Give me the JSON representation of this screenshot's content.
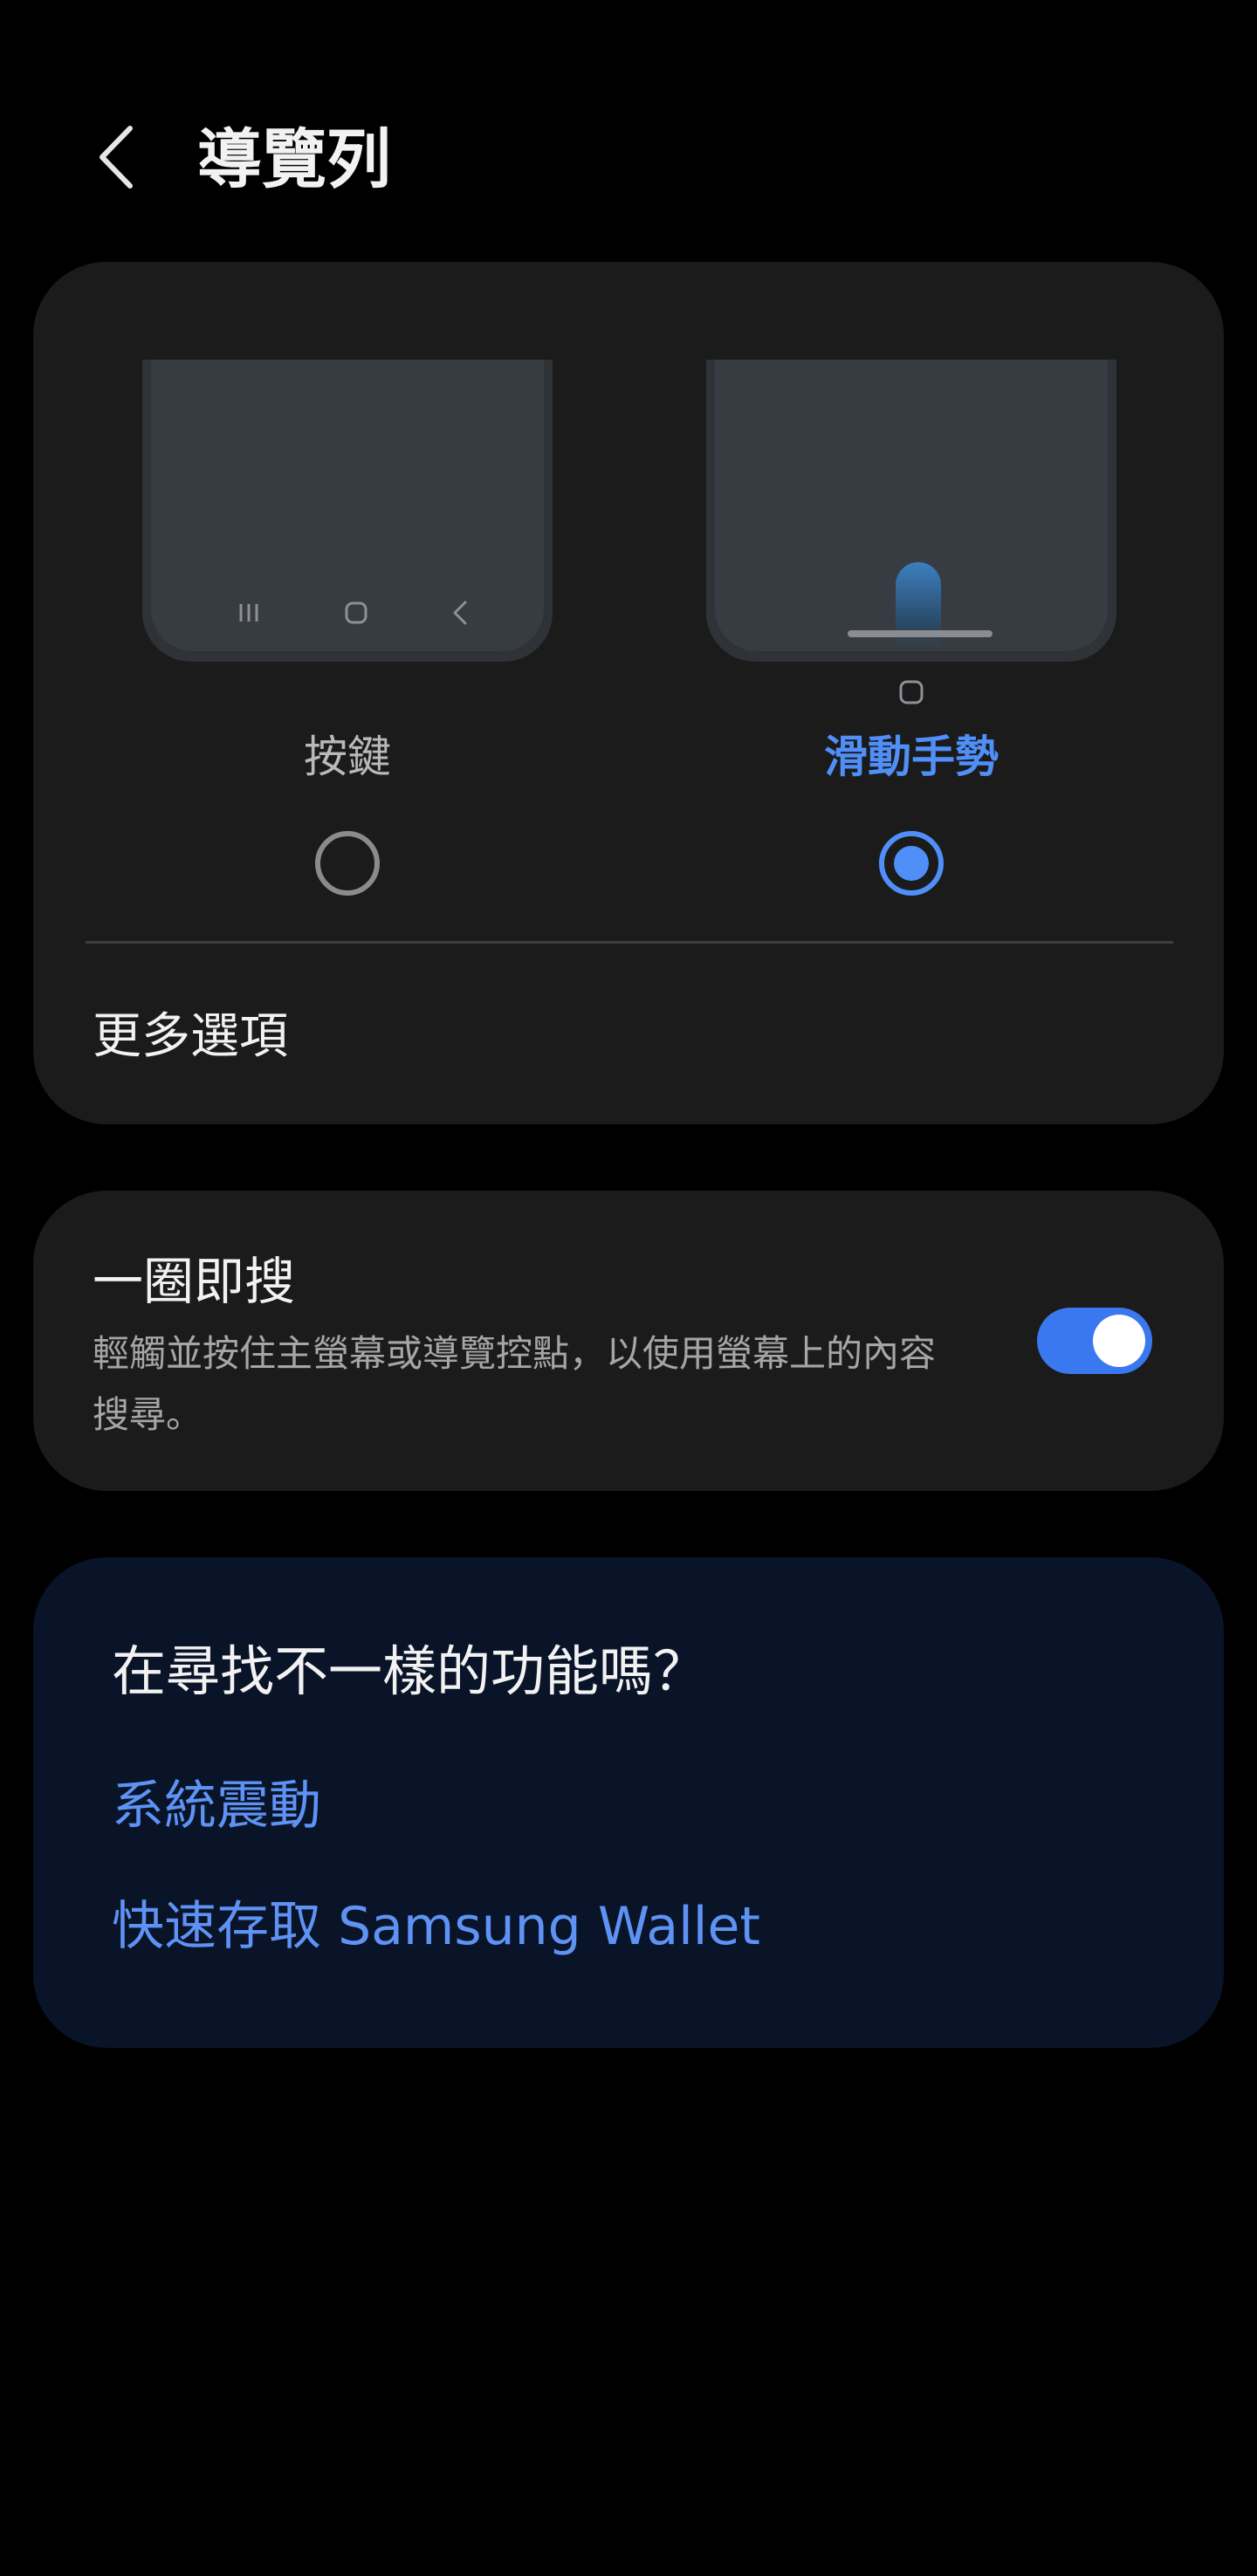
{
  "header": {
    "title": "導覽列",
    "back_icon": "chevron-left-icon"
  },
  "navigation_type": {
    "options": [
      {
        "label": "按鍵",
        "selected": false
      },
      {
        "label": "滑動手勢",
        "selected": true
      }
    ],
    "more_options_label": "更多選項"
  },
  "circle_to_search": {
    "title": "一圈即搜",
    "description": "輕觸並按住主螢幕或導覽控點，以使用螢幕上的內容搜尋。",
    "enabled": true
  },
  "suggestions": {
    "title": "在尋找不一樣的功能嗎？",
    "links": [
      "系統震動",
      "快速存取 Samsung Wallet"
    ]
  },
  "colors": {
    "background": "#000000",
    "card": "#1b1b1b",
    "suggestion_card": "#0a1428",
    "accent": "#4f8ff7",
    "toggle_on": "#3a78f0"
  }
}
